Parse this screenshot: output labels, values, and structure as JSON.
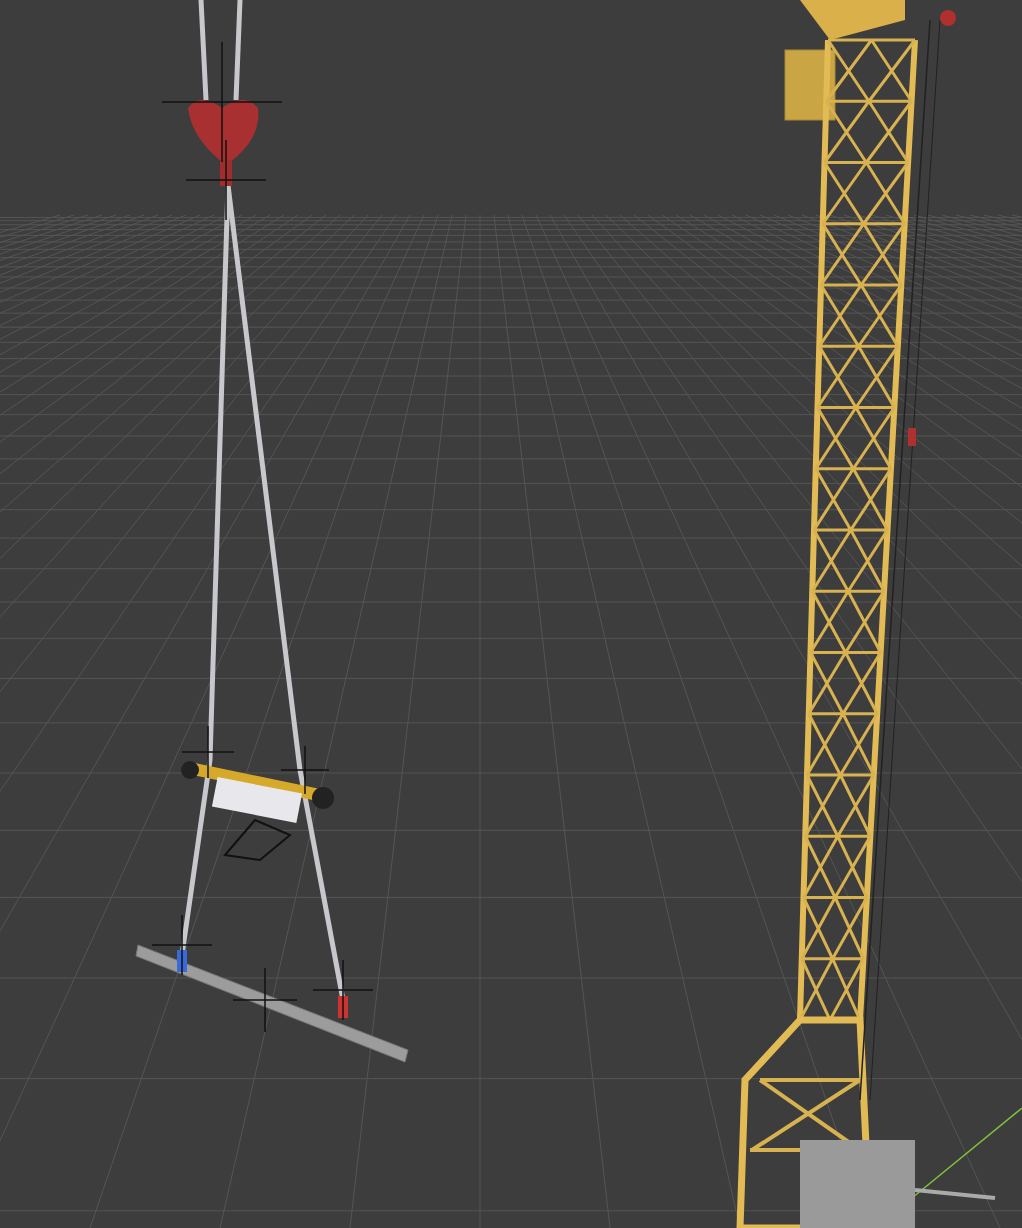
{
  "viewport": {
    "grid_visible": true,
    "axis_visible": true,
    "objects": [
      {
        "kind": "tower_crane"
      },
      {
        "kind": "slings"
      },
      {
        "kind": "hook"
      },
      {
        "kind": "spreader"
      },
      {
        "kind": "beam"
      },
      {
        "kind": "empties"
      }
    ]
  }
}
